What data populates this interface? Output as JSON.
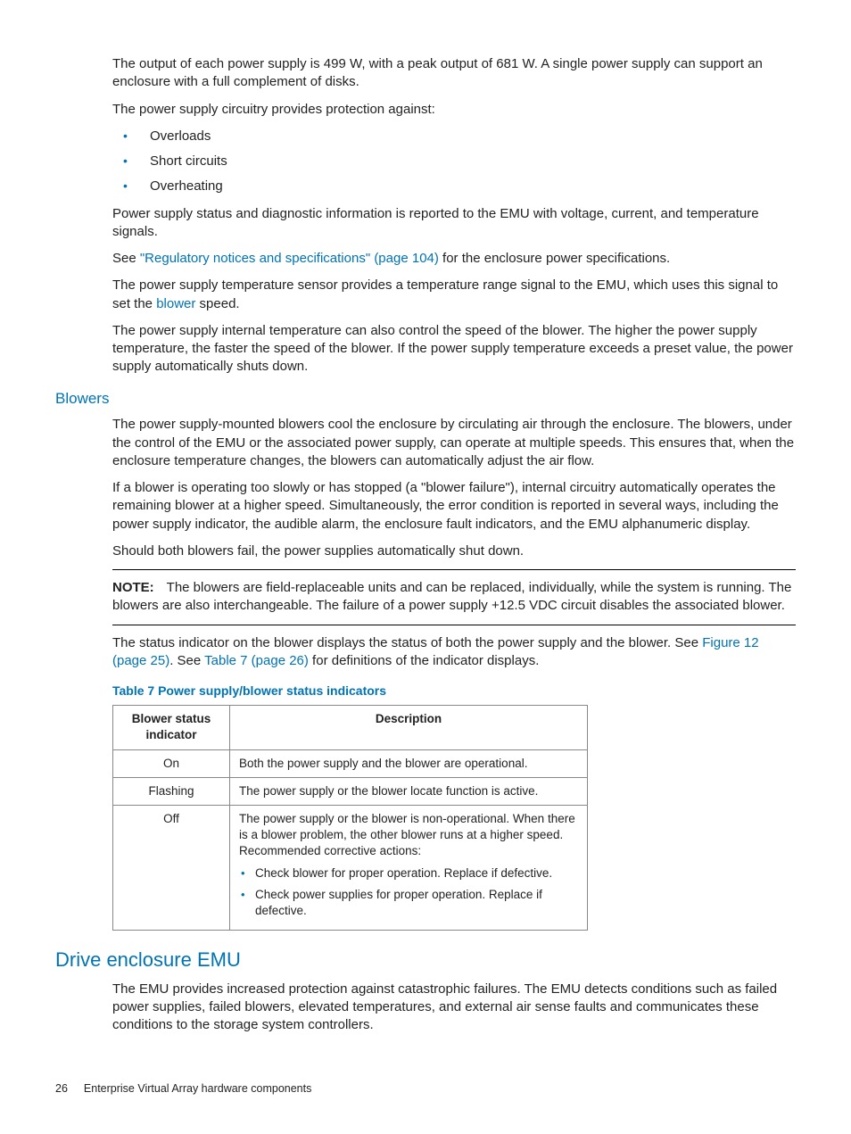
{
  "intro": {
    "p1": "The output of each power supply is 499 W, with a peak output of 681 W. A single power supply can support an enclosure with a full complement of disks.",
    "p2": "The power supply circuitry provides protection against:",
    "bullets": [
      "Overloads",
      "Short circuits",
      "Overheating"
    ],
    "p3": "Power supply status and diagnostic information is reported to the EMU with voltage, current, and temperature signals.",
    "p4a": "See ",
    "p4link": "\"Regulatory notices and specifications\" (page 104)",
    "p4b": " for the enclosure power specifications.",
    "p5a": "The power supply temperature sensor provides a temperature range signal to the EMU, which uses this signal to set the ",
    "p5link": "blower",
    "p5b": " speed.",
    "p6": "The power supply internal temperature can also control the speed of the blower. The higher the power supply temperature, the faster the speed of the blower. If the power supply temperature exceeds a preset value, the power supply automatically shuts down."
  },
  "blowers": {
    "heading": "Blowers",
    "p1": "The power supply-mounted blowers cool the enclosure by circulating air through the enclosure. The blowers, under the control of the EMU or the associated power supply, can operate at multiple speeds. This ensures that, when the enclosure temperature changes, the blowers can automatically adjust the air flow.",
    "p2": "If a blower is operating too slowly or has stopped (a \"blower failure\"), internal circuitry automatically operates the remaining blower at a higher speed. Simultaneously, the error condition is reported in several ways, including the power supply indicator, the audible alarm, the enclosure fault indicators, and the EMU alphanumeric display.",
    "p3": "Should both blowers fail, the power supplies automatically shut down.",
    "note_label": "NOTE:",
    "note_body": "The blowers are field-replaceable units and can be replaced, individually, while the system is running. The blowers are also interchangeable. The failure of a power supply +12.5 VDC circuit disables the associated blower.",
    "p4a": "The status indicator on the blower displays the status of both the power supply and the blower. See ",
    "p4link1": "Figure 12 (page 25)",
    "p4mid": ". See ",
    "p4link2": "Table 7 (page 26)",
    "p4b": " for definitions of the indicator displays."
  },
  "table": {
    "caption": "Table 7 Power supply/blower status indicators",
    "col1": "Blower status indicator",
    "col2": "Description",
    "rows": [
      {
        "ind": "On",
        "desc": "Both the power supply and the blower are operational."
      },
      {
        "ind": "Flashing",
        "desc": "The power supply or the blower locate function is active."
      },
      {
        "ind": "Off",
        "desc": "The power supply or the blower is non-operational. When there is a blower problem, the other blower runs at a higher speed. Recommended corrective actions:",
        "items": [
          "Check blower for proper operation. Replace if defective.",
          "Check power supplies for proper operation. Replace if defective."
        ]
      }
    ]
  },
  "emu": {
    "heading": "Drive enclosure EMU",
    "p1": "The EMU provides increased protection against catastrophic failures. The EMU detects conditions such as failed power supplies, failed blowers, elevated temperatures, and external air sense faults and communicates these conditions to the storage system controllers."
  },
  "footer": {
    "page": "26",
    "title": "Enterprise Virtual Array hardware components"
  }
}
